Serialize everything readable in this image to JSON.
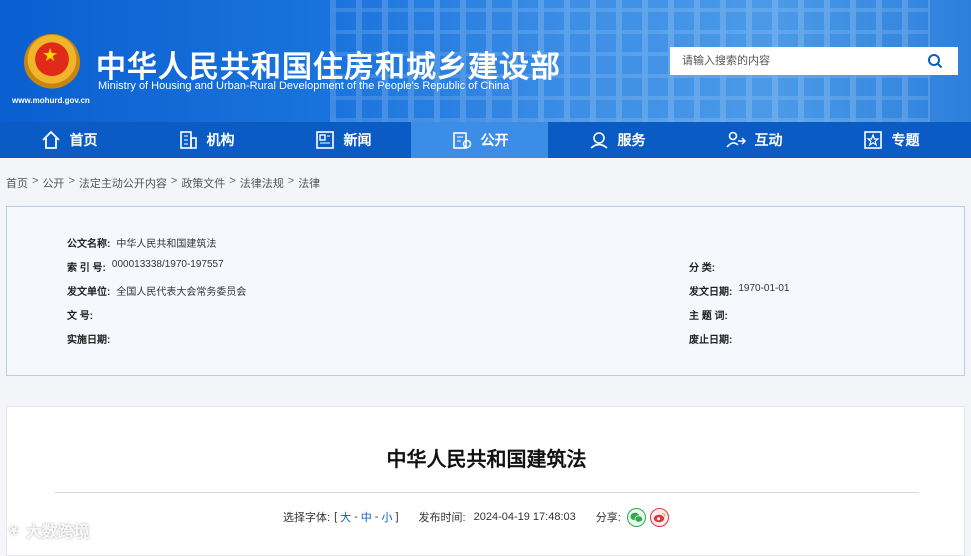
{
  "header": {
    "title": "中华人民共和国住房和城乡建设部",
    "subtitle": "Ministry of Housing and Urban-Rural Development of the People's Republic of China",
    "url": "www.mohurd.gov.cn"
  },
  "search": {
    "placeholder": "请输入搜索的内容"
  },
  "nav": [
    {
      "label": "首页",
      "icon": "home-icon"
    },
    {
      "label": "机构",
      "icon": "building-icon"
    },
    {
      "label": "新闻",
      "icon": "news-icon"
    },
    {
      "label": "公开",
      "icon": "document-icon",
      "active": true
    },
    {
      "label": "服务",
      "icon": "service-icon"
    },
    {
      "label": "互动",
      "icon": "interact-icon"
    },
    {
      "label": "专题",
      "icon": "star-icon"
    }
  ],
  "breadcrumb": [
    "首页",
    "公开",
    "法定主动公开内容",
    "政策文件",
    "法律法规",
    "法律"
  ],
  "info": {
    "doc_name_label": "公文名称:",
    "doc_name": "中华人民共和国建筑法",
    "index_label": "索 引 号:",
    "index": "000013338/1970-197557",
    "category_label": "分 类:",
    "category": "",
    "issuer_label": "发文单位:",
    "issuer": "全国人民代表大会常务委员会",
    "issue_date_label": "发文日期:",
    "issue_date": "1970-01-01",
    "doc_no_label": "文 号:",
    "doc_no": "",
    "subject_label": "主 题 词:",
    "subject": "",
    "effective_label": "实施日期:",
    "effective": "",
    "expiry_label": "废止日期:",
    "expiry": ""
  },
  "article": {
    "title": "中华人民共和国建筑法",
    "font_size_label": "选择字体:",
    "font_bracket_open": "[",
    "font_large": "大",
    "font_medium": "中",
    "font_small": "小",
    "font_sep": "-",
    "font_bracket_close": "]",
    "publish_label": "发布时间:",
    "publish_time": "2024-04-19 17:48:03",
    "share_label": "分享:"
  },
  "watermark": "大数跨境",
  "colors": {
    "primary": "#0a5cc4",
    "active_nav": "#3b8de6",
    "info_bg": "#f5f9fe",
    "info_border": "#b6d0ec"
  }
}
